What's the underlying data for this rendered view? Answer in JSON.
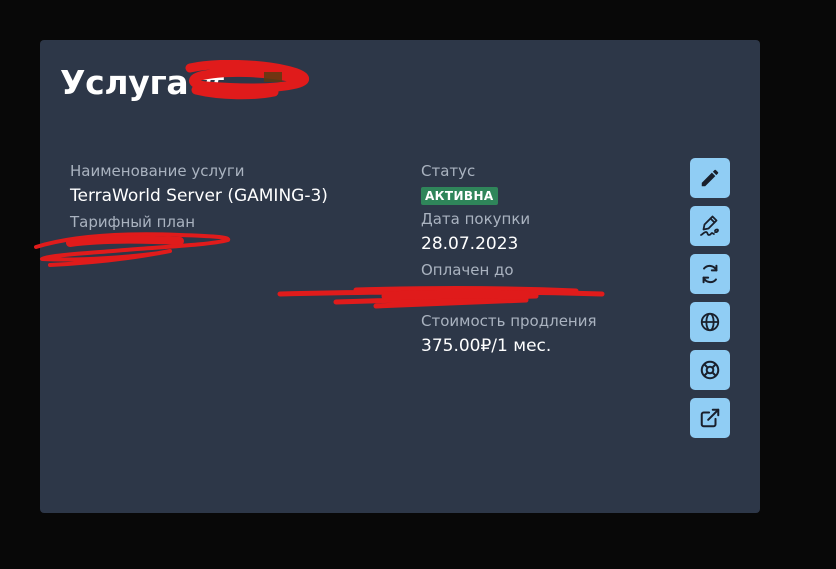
{
  "service": {
    "title": "Услуга",
    "id_prefix": "#"
  },
  "details": {
    "service_name_label": "Наименование услуги",
    "service_name": "TerraWorld Server (GAMING-3)",
    "plan_label": "Тарифный план",
    "status_label": "Статус",
    "status": "АКТИВНА",
    "purchase_date_label": "Дата покупки",
    "purchase_date": "28.07.2023",
    "paid_until_label": "Оплачен до",
    "renewal_cost_label": "Стоимость продления",
    "renewal_cost": "375.00₽/1 мес."
  },
  "actions": [
    {
      "icon": "pencil-icon"
    },
    {
      "icon": "signature-icon"
    },
    {
      "icon": "refresh-icon"
    },
    {
      "icon": "globe-icon"
    },
    {
      "icon": "lifebuoy-icon"
    },
    {
      "icon": "external-link-icon"
    }
  ],
  "colors": {
    "page_bg": "#080808",
    "card_bg": "#2d3748",
    "status_badge": "#2f855a",
    "action_button": "#90cdf4",
    "redaction": "#e01b1b"
  }
}
